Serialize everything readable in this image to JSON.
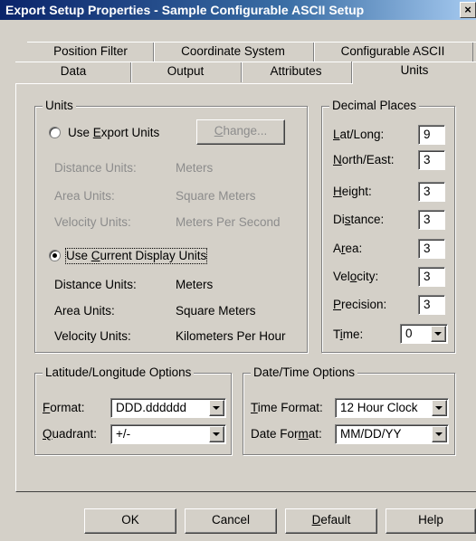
{
  "window": {
    "title": "Export Setup Properties - Sample Configurable ASCII Setup",
    "close_label": "×"
  },
  "tabs": {
    "row1": [
      "Position Filter",
      "Coordinate System",
      "Configurable ASCII"
    ],
    "row2": [
      "Data",
      "Output",
      "Attributes",
      "Units"
    ],
    "active": "Units"
  },
  "units": {
    "legend": "Units",
    "export_radio": {
      "label_pre": "Use ",
      "label_key": "E",
      "label_post": "xport Units",
      "selected": false
    },
    "change_button": {
      "label_key": "C",
      "label_rest": "hange..."
    },
    "export_rows": [
      {
        "label": "Distance Units:",
        "value": "Meters"
      },
      {
        "label": "Area Units:",
        "value": "Square Meters"
      },
      {
        "label": "Velocity Units:",
        "value": "Meters Per Second"
      }
    ],
    "display_radio": {
      "label_pre": "Use ",
      "label_key": "C",
      "label_post": "urrent Display Units",
      "selected": true
    },
    "display_rows": [
      {
        "label": "Distance Units:",
        "value": "Meters"
      },
      {
        "label": "Area Units:",
        "value": "Square Meters"
      },
      {
        "label": "Velocity Units:",
        "value": "Kilometers Per Hour"
      }
    ]
  },
  "decimal_places": {
    "legend": "Decimal Places",
    "latlong": {
      "pre": "",
      "key": "L",
      "post": "at/Long:",
      "value": "9"
    },
    "northeast": {
      "pre": "",
      "key": "N",
      "post": "orth/East:",
      "value": "3"
    },
    "height": {
      "pre": "",
      "key": "H",
      "post": "eight:",
      "value": "3"
    },
    "distance": {
      "pre": "Di",
      "key": "s",
      "post": "tance:",
      "value": "3"
    },
    "area": {
      "pre": "A",
      "key": "r",
      "post": "ea:",
      "value": "3"
    },
    "velocity": {
      "pre": "Vel",
      "key": "o",
      "post": "city:",
      "value": "3"
    },
    "precision": {
      "pre": "",
      "key": "P",
      "post": "recision:",
      "value": "3"
    },
    "time": {
      "pre": "T",
      "key": "i",
      "post": "me:",
      "value": "0"
    }
  },
  "latlong_options": {
    "legend": "Latitude/Longitude Options",
    "format": {
      "key": "F",
      "post": "ormat:",
      "value": "DDD.dddddd"
    },
    "quadrant": {
      "key": "Q",
      "post": "uadrant:",
      "value": "+/-"
    }
  },
  "datetime_options": {
    "legend": "Date/Time Options",
    "time_format": {
      "pre": "",
      "key": "T",
      "post": "ime Format:",
      "value": "12 Hour Clock"
    },
    "date_format": {
      "pre": "Date For",
      "key": "m",
      "post": "at:",
      "value": "MM/DD/YY"
    }
  },
  "footer": {
    "ok": "OK",
    "cancel": "Cancel",
    "default_key": "D",
    "default_rest": "efault",
    "help": "Help"
  }
}
